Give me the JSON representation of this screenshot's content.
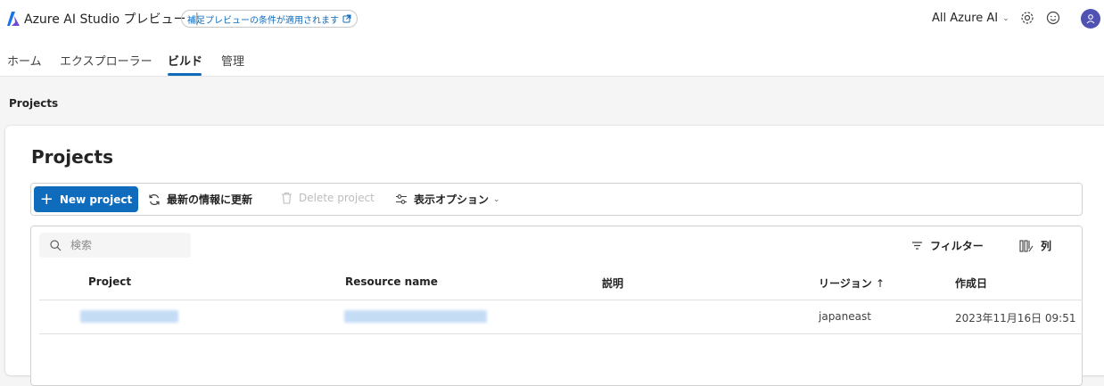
{
  "header": {
    "app_title": "Azure AI Studio プレビュー",
    "separator": "|",
    "preview_notice": "補足プレビューの条件が適用されます",
    "scope_label": "All Azure AI"
  },
  "nav": {
    "tabs": [
      {
        "label": "ホーム",
        "active": false
      },
      {
        "label": "エクスプローラー",
        "active": false
      },
      {
        "label": "ビルド",
        "active": true
      },
      {
        "label": "管理",
        "active": false
      }
    ]
  },
  "breadcrumb": "Projects",
  "page_title": "Projects",
  "toolbar": {
    "new_project": "New project",
    "refresh": "最新の情報に更新",
    "delete_project": "Delete project",
    "view_options": "表示オプション"
  },
  "table": {
    "search_placeholder": "検索",
    "filter_label": "フィルター",
    "columns_label": "列",
    "headers": {
      "project": "Project",
      "resource_name": "Resource name",
      "description": "説明",
      "region": "リージョン",
      "region_sort": "↑",
      "created": "作成日"
    },
    "rows": [
      {
        "region": "japaneast",
        "created": "2023年11月16日 09:51"
      }
    ]
  },
  "colors": {
    "accent": "#0f6cbd",
    "avatar": "#4f52b2"
  },
  "icons": [
    "azure-ai-logo",
    "external-link-icon",
    "chevron-down-icon",
    "gear-icon",
    "smiley-icon",
    "person-icon",
    "plus-icon",
    "refresh-icon",
    "trash-icon",
    "options-icon",
    "search-icon",
    "filter-icon",
    "columns-icon",
    "sort-ascending-icon"
  ]
}
